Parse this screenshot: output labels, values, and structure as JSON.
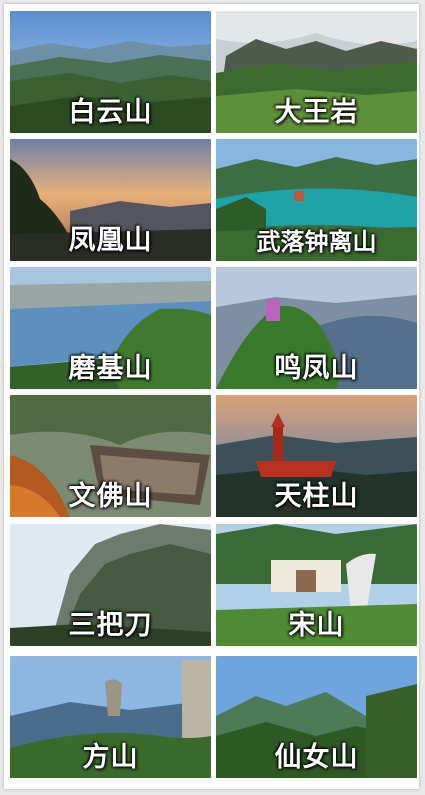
{
  "tiles": [
    {
      "label": "白云山"
    },
    {
      "label": "大王岩"
    },
    {
      "label": "凤凰山"
    },
    {
      "label": "武落钟离山"
    },
    {
      "label": "磨基山"
    },
    {
      "label": "鸣凤山"
    },
    {
      "label": "文佛山"
    },
    {
      "label": "天柱山"
    },
    {
      "label": "三把刀"
    },
    {
      "label": "宋山"
    },
    {
      "label": "方山"
    },
    {
      "label": "仙女山"
    }
  ]
}
